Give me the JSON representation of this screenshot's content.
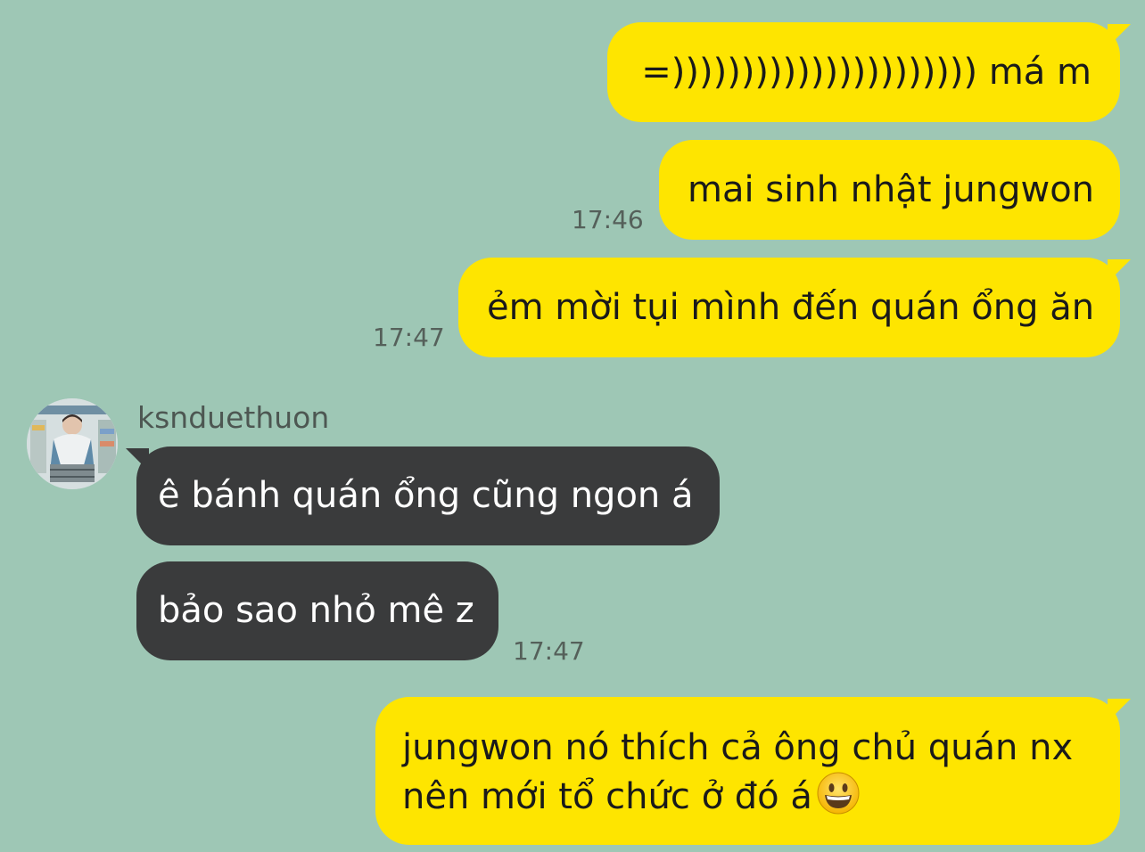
{
  "messages": {
    "m1": {
      "text": "=)))))))))))))))))))))) má m"
    },
    "m2": {
      "text": "mai sinh nhật jungwon",
      "time": "17:46"
    },
    "m3": {
      "text": "ẻm mời tụi mình đến quán ổng ăn",
      "time": "17:47"
    },
    "sender_name": "ksnduethuon",
    "m4": {
      "text": "ê bánh quán ổng cũng ngon á"
    },
    "m5": {
      "text": "bảo sao nhỏ mê z",
      "time": "17:47"
    },
    "m6": {
      "line1": "jungwon nó thích cả ông chủ quán nx",
      "line2": "nên mới tổ chức ở đó á"
    }
  },
  "colors": {
    "background": "#9ec7b5",
    "outgoing_bubble": "#fee500",
    "incoming_bubble": "#3a3b3c"
  },
  "icons": {
    "emoji": "grinning-face-emoji"
  }
}
